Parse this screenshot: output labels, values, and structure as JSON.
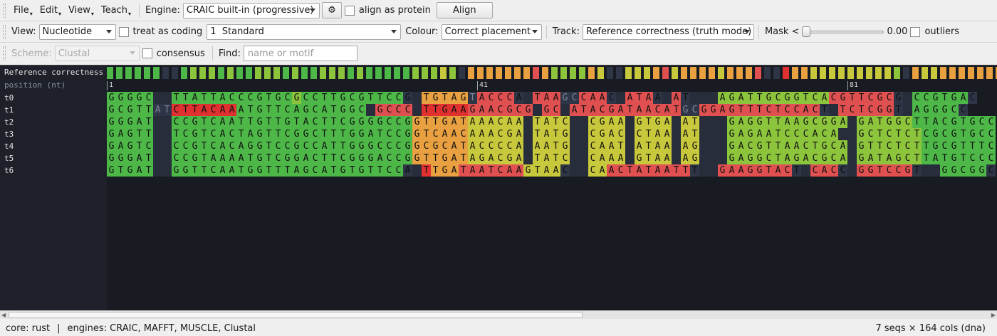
{
  "menu": [
    "File",
    "Edit",
    "View",
    "Teach"
  ],
  "toolbar": {
    "engine_label": "Engine:",
    "engine_value": "CRAIC built-in (progressive)",
    "settings_icon": "gear-icon",
    "protein_label": "align as protein",
    "align_label": "Align"
  },
  "viewbar": {
    "view_label": "View:",
    "view_value": "Nucleotide",
    "coding_label": "treat as coding",
    "code_value": "1  Standard",
    "colour_label": "Colour:",
    "colour_value": "Correct placement",
    "track_label": "Track:",
    "track_value": "Reference correctness (truth mode)",
    "mask_label": "Mask <",
    "mask_value": 0.0,
    "mask_text": "0.00",
    "outliers_label": "outliers"
  },
  "findbar": {
    "scheme_label": "Scheme:",
    "scheme_value": "Clustal",
    "consensus_label": "consensus",
    "find_label": "Find:",
    "find_placeholder": "name or motif"
  },
  "alignment": {
    "track_name": "Reference correctness",
    "position_label": "position (nt)",
    "position_ticks": [
      {
        "col": 0,
        "label": "1"
      },
      {
        "col": 40,
        "label": "41"
      },
      {
        "col": 80,
        "label": "81"
      }
    ],
    "colors": {
      "g": "#4db848",
      "l": "#8cc43c",
      "y": "#c8c83c",
      "o": "#e8a040",
      "r": "#e05050",
      "R": "#e03030",
      "n": "#2e3546",
      "gap": "#272d3a"
    },
    "track": "ggggggnnglllglgglllglgglllglggggglllylnooooooorolllloynnyyyoryooooyooornnRooyyyyyyyyylnoyyooooooooooggggggggggggggg",
    "sequences": [
      {
        "name": "t0",
        "seq": "GGGGC--TTATTACCCGTGCGCCTTGCGTTCCG-TGTAGTACCCA-TAAGCCAAC-ATAA-AT---AGATTGCGGTCACGTTCGCG-CCGTGAC",
        "col": "ggggg--ggggggggggggglggggggggggg-oooooonrrrr-rrrrnnrrr-rrrr-rr---lllllllllllllrrrrrrr-ggggggg"
      },
      {
        "name": "t1",
        "seq": "GCGTTATCTTACAAATGTTCAGCATGGC-GCCC-TTGAAGAACGCG-GC-ATACGATAACATGCGGAGTTTCTCCACT-TCTCGGT-AGGGCC",
        "col": "gggggnnRRRRRRRgggggggggggggg-rrrr-RRRRRrrrrrrr-rr-rrrrrrrrrrrrnnrrrrrrrrrrrrr-rrrrrrr-gggggg"
      },
      {
        "name": "t2",
        "seq": "GGGAT--CCGTCAATTGTTGTACTTCGGGGCCGGTTGATAAACAA-TATC--CGAA-GTGA-AT---GAGGTTAAGCGGA-GATGGCTTACGTGCC",
        "col": "ggggg--ggggggggggggggggggggggggggooooooyyyyyy-yyyy--yyyy-yyyy-yy---lllllllllllll-llllllggggggggg"
      },
      {
        "name": "t3",
        "seq": "GAGTT--TCGTCACTAGTTCGGCTTTGGATCCGGTCAACAAACGA-TATG--CGAC-CTAA-AT---GAGAATCCCACA--GCTCTCTCGCGTGCC",
        "col": "ggggg--ggggggggggggggggggggggggggooooooyyyyyy-yyyy--yyyy-yyyy-yy---llllllllllll--lllllllggggggggg"
      },
      {
        "name": "t4",
        "seq": "GAGTC--CCGTCACAGGTCCGCCATTGGGCCCGGCGCATACCCCA-AATG--CAAT-ATAA-AG---GACGTTAACTGCA-GTTCTCTTGCGTTTC",
        "col": "ggggg--ggggggggggggggggggggggggggooooooyyyyyy-yyyy--yyyy-yyyy-yy---lllllllllllll-lllllllggggggggg"
      },
      {
        "name": "t5",
        "seq": "GGGAT--CCGTAAAATGTCGGACTTCGGGACCGGTTGATAGACGA-TATC--CAAA-GTAA-AG---GAGGCTAGACGCA-GATAGCTTATGTCCC",
        "col": "ggggg--ggggggggggggggggggggggggggooooooyyyyyy-yyyy--yyyy-yyyy-yy---lllllllllllll-lllllllggggggggg"
      },
      {
        "name": "t6",
        "seq": "GTGAT--GGTTCAATGGTTTAGCATGTGTTCCA-TTGATAATCAAGTAAC--CAACTATAATTT--GAAGGTACT-CACC-GGTCCGT--GGCGGC",
        "col": "ggggg--ggggggggggggggggggggggggg-RRooorrrrrrryyyy--yyyrrrrrrrrr--rrrrrrrrr-rrrr-rrrrrrr--gggggg"
      }
    ]
  },
  "status": {
    "core": "core: rust",
    "sep": "|",
    "engines": "engines: CRAIC, MAFFT, MUSCLE, Clustal",
    "size": "7 seqs × 164 cols (dna)"
  }
}
